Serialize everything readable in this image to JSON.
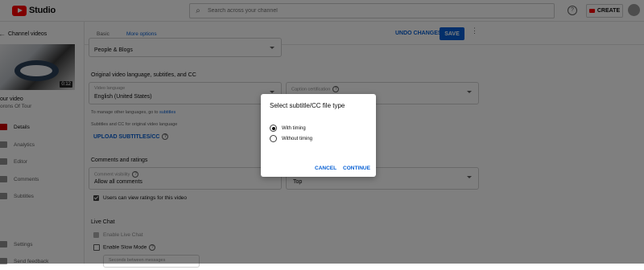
{
  "topbar": {
    "logo_text": "Studio",
    "search_placeholder": "Search across your channel",
    "help_label": "?",
    "create_label": "CREATE"
  },
  "sidebar": {
    "back_label": "Channel videos",
    "thumbnail_duration": "0:12",
    "your_video_label": "our video",
    "channel_name": "orons Of Tour",
    "items": [
      {
        "label": "Details",
        "active": true
      },
      {
        "label": "Analytics"
      },
      {
        "label": "Editor"
      },
      {
        "label": "Comments"
      },
      {
        "label": "Subtitles"
      }
    ],
    "settings_label": "Settings",
    "feedback_label": "Send feedback"
  },
  "main": {
    "tabs": [
      {
        "label": "Basic"
      },
      {
        "label": "More options",
        "active": true
      }
    ],
    "undo_label": "UNDO CHANGES",
    "save_label": "SAVE",
    "category_value": "People & Blogs",
    "section_language_title": "Original video language, subtitles, and CC",
    "video_language_label": "Video language",
    "video_language_value": "English (United States)",
    "caption_cert_label": "Caption certification",
    "manage_text": "To manage other languages, go to",
    "manage_link": "subtitles",
    "subtitles_note": "Subtitles and CC for original video language",
    "upload_subtitles_label": "UPLOAD SUBTITLES/CC",
    "section_comments_title": "Comments and ratings",
    "comment_visibility_label": "Comment visibility",
    "comment_visibility_value": "Allow all comments",
    "sort_value": "Top",
    "ratings_label": "Users can view ratings for this video",
    "section_live_chat_title": "Live Chat",
    "enable_live_chat_label": "Enable Live Chat",
    "enable_slow_mode_label": "Enable Slow Mode",
    "seconds_placeholder": "Seconds between messages"
  },
  "dialog": {
    "title": "Select subtitle/CC file type",
    "options": [
      {
        "label": "With timing",
        "selected": true
      },
      {
        "label": "Without timing",
        "selected": false
      }
    ],
    "cancel_label": "CANCEL",
    "continue_label": "CONTINUE"
  }
}
